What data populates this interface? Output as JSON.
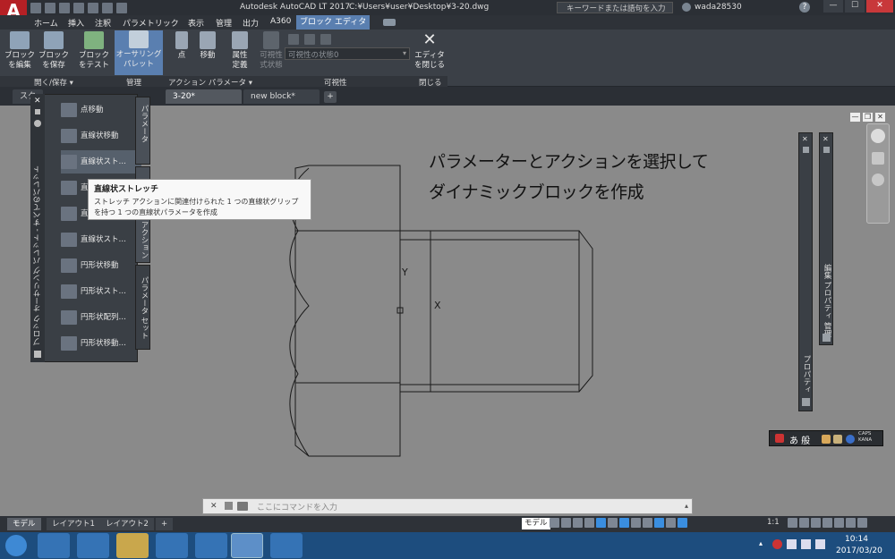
{
  "titlebar": {
    "app_title": "Autodesk AutoCAD LT 2017",
    "file_path": "C:¥Users¥user¥Desktop¥3-20.dwg",
    "search_placeholder": "キーワードまたは語句を入力",
    "user": "wada28530"
  },
  "menubar": {
    "logo": "A",
    "logo_sub": "LT",
    "items": [
      "ホーム",
      "挿入",
      "注釈",
      "パラメトリック",
      "表示",
      "管理",
      "出力",
      "A360",
      "ブロック エディタ"
    ],
    "active": "ブロック エディタ"
  },
  "ribbon": {
    "buttons": [
      {
        "label": "ブロック\nを編集"
      },
      {
        "label": "ブロック\nを保存"
      },
      {
        "label": "ブロック\nをテスト"
      },
      {
        "label": "オーサリング\nパレット"
      },
      {
        "label": "点"
      },
      {
        "label": "移動"
      },
      {
        "label": "属性\n定義"
      },
      {
        "label": "可視性\n式状態"
      },
      {
        "label": "エディタ\nを閉じる"
      }
    ],
    "visibility_dropdown": "可視性の状態0",
    "groups": [
      "開く/保存 ▾",
      "管理",
      "アクション パラメータ ▾",
      "可視性",
      "閉じる"
    ]
  },
  "doc_tabs": [
    "スタ",
    "3-20*",
    "new block*"
  ],
  "palette": {
    "side_title": "ブロック オーサリング パレット - すべてのパレット",
    "items": [
      "点移動",
      "直線状移動",
      "直線状スト…",
      "直",
      "直",
      "直線状スト…",
      "円形状移動",
      "円形状スト…",
      "円形状配列…",
      "円形状移動…"
    ],
    "tabs": [
      "パラメータ",
      "アクション",
      "パラメータ セット"
    ]
  },
  "tooltip": {
    "title": "直線状ストレッチ",
    "body_line1": "ストレッチ アクションに関連付けられた 1 つの直線状グリップ",
    "body_line2": "を持つ 1 つの直線状パラメータを作成"
  },
  "canvas": {
    "heading_line1": "パラメーターとアクションを選択して",
    "heading_line2": "ダイナミックブロックを作成",
    "axis_y": "Y",
    "axis_x": "X"
  },
  "right_panels": {
    "panel1_title": "プロパティ",
    "panel2_title": "編集 プロパティ 管理"
  },
  "ime_bar": {
    "text": "あ 般",
    "caps": "CAPS\nKANA"
  },
  "command_line": {
    "placeholder": "ここにコマンドを入力"
  },
  "layout_tabs": [
    "モデル",
    "レイアウト1",
    "レイアウト2",
    "+"
  ],
  "status": {
    "model": "モデル",
    "scale": "1:1"
  },
  "taskbar": {
    "time": "10:14",
    "date": "2017/03/20"
  }
}
